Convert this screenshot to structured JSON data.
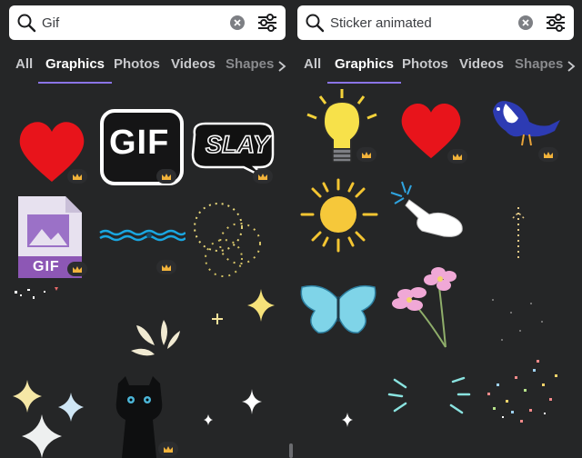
{
  "left": {
    "search": {
      "value": "Gif",
      "placeholder": "Search"
    },
    "tabs": [
      "All",
      "Graphics",
      "Photos",
      "Videos",
      "Shapes"
    ],
    "active_tab": "Graphics",
    "gif_badge": "GIF",
    "gif_file_label": "GIF",
    "slay_text": "SLAY"
  },
  "right": {
    "search": {
      "value": "Sticker animated",
      "placeholder": "Search"
    },
    "tabs": [
      "All",
      "Graphics",
      "Photos",
      "Videos",
      "Shapes"
    ],
    "active_tab": "Graphics"
  },
  "icons": {
    "search": "search-icon",
    "clear": "clear-icon",
    "filter": "filter-icon",
    "chevron": "chevron-right-icon",
    "premium": "crown-icon"
  },
  "colors": {
    "background": "#252627",
    "accent": "#8b74e6",
    "heart": "#e8141b",
    "premium": "#f2b33b"
  }
}
